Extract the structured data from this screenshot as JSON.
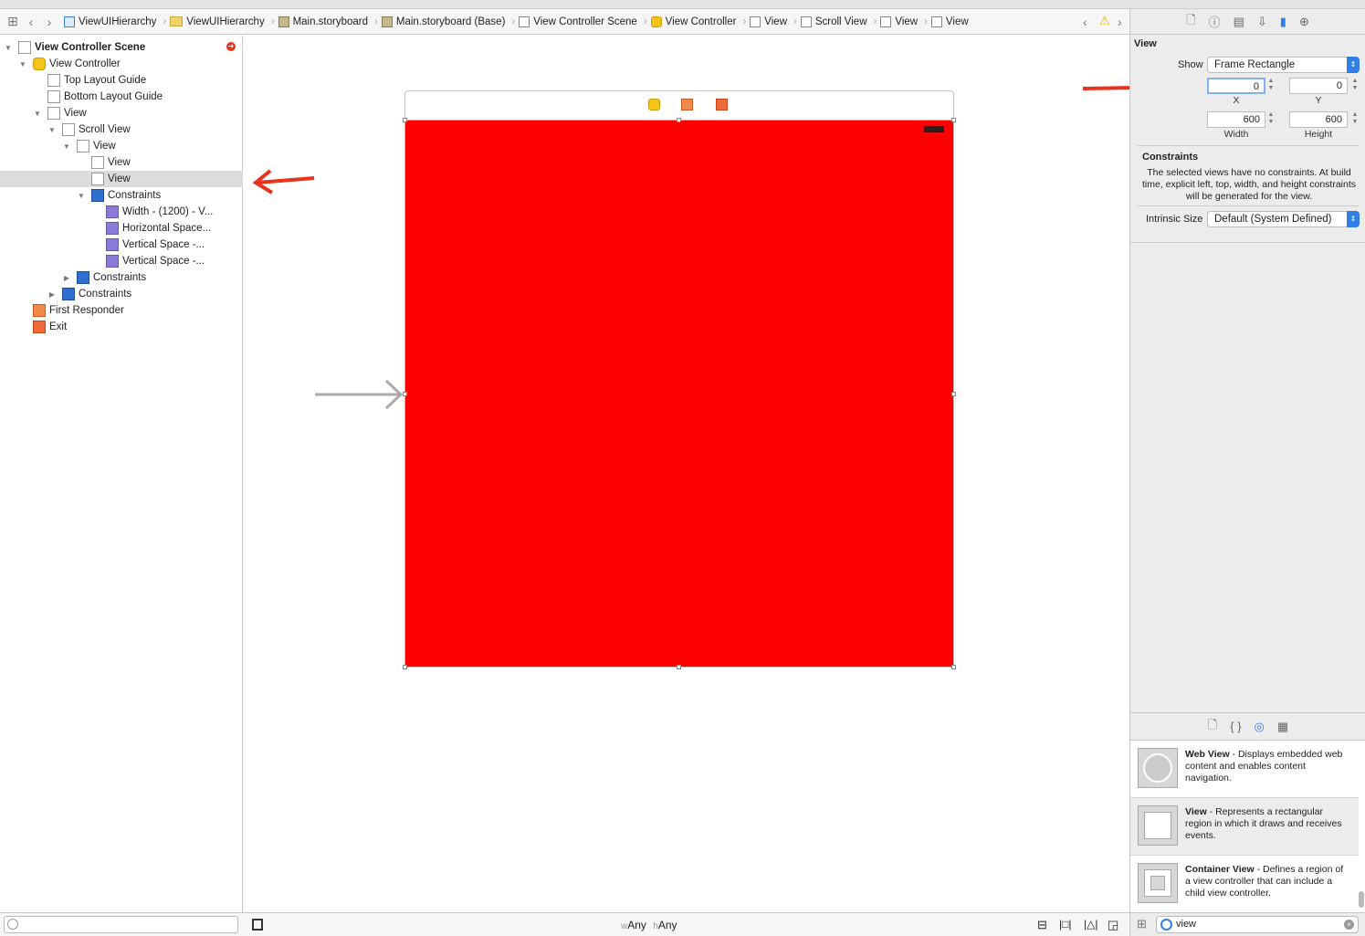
{
  "jumpbar": {
    "crumbs": [
      {
        "label": "ViewUIHierarchy",
        "icon": "project-file-icon"
      },
      {
        "label": "ViewUIHierarchy",
        "icon": "folder-icon"
      },
      {
        "label": "Main.storyboard",
        "icon": "storyboard-icon"
      },
      {
        "label": "Main.storyboard (Base)",
        "icon": "storyboard-icon"
      },
      {
        "label": "View Controller Scene",
        "icon": "scene-icon"
      },
      {
        "label": "View Controller",
        "icon": "view-controller-icon"
      },
      {
        "label": "View",
        "icon": "view-icon"
      },
      {
        "label": "Scroll View",
        "icon": "scroll-view-icon"
      },
      {
        "label": "View",
        "icon": "view-icon"
      },
      {
        "label": "View",
        "icon": "view-icon"
      }
    ]
  },
  "outline": {
    "items": [
      {
        "label": "View Controller Scene",
        "level": 0,
        "icon": "scene-icon",
        "expanded": true,
        "bold": true
      },
      {
        "label": "View Controller",
        "level": 1,
        "icon": "view-controller-icon",
        "expanded": true
      },
      {
        "label": "Top Layout Guide",
        "level": 2,
        "icon": "layout-guide-icon"
      },
      {
        "label": "Bottom Layout Guide",
        "level": 2,
        "icon": "layout-guide-icon"
      },
      {
        "label": "View",
        "level": 2,
        "icon": "view-icon",
        "expanded": true
      },
      {
        "label": "Scroll View",
        "level": 3,
        "icon": "scroll-view-icon",
        "expanded": true
      },
      {
        "label": "View",
        "level": 4,
        "icon": "view-icon",
        "expanded": true
      },
      {
        "label": "View",
        "level": 5,
        "icon": "view-icon"
      },
      {
        "label": "View",
        "level": 5,
        "icon": "view-icon",
        "selected": true
      },
      {
        "label": "Constraints",
        "level": 5,
        "icon": "constraints-icon",
        "expanded": true
      },
      {
        "label": "Width - (1200) - V...",
        "level": 6,
        "icon": "constraint-icon"
      },
      {
        "label": "Horizontal Space...",
        "level": 6,
        "icon": "constraint-icon"
      },
      {
        "label": "Vertical Space -...",
        "level": 6,
        "icon": "constraint-icon"
      },
      {
        "label": "Vertical Space -...",
        "level": 6,
        "icon": "constraint-icon"
      },
      {
        "label": "Constraints",
        "level": 4,
        "icon": "constraints-icon",
        "expanded": false
      },
      {
        "label": "Constraints",
        "level": 3,
        "icon": "constraints-icon",
        "expanded": false
      },
      {
        "label": "First Responder",
        "level": 1,
        "icon": "first-responder-icon"
      },
      {
        "label": "Exit",
        "level": 1,
        "icon": "exit-icon"
      }
    ]
  },
  "canvas": {
    "view_color": "#ff0000",
    "size_class_w": "w",
    "size_class_w_val": "Any",
    "size_class_h": "h",
    "size_class_h_val": "Any"
  },
  "inspector": {
    "section_title": "View",
    "show_label": "Show",
    "show_value": "Frame Rectangle",
    "x": "0",
    "x_label": "X",
    "y": "0",
    "y_label": "Y",
    "width": "600",
    "width_label": "Width",
    "height": "600",
    "height_label": "Height",
    "constraints_title": "Constraints",
    "constraints_text": "The selected views have no constraints. At build time, explicit left, top, width, and height constraints will be generated for the view.",
    "intrinsic_label": "Intrinsic Size",
    "intrinsic_value": "Default (System Defined)"
  },
  "library": {
    "items": [
      {
        "name": "Web View",
        "desc": " - Displays embedded web content and enables content navigation."
      },
      {
        "name": "View",
        "desc": " - Represents a rectangular region in which it draws and receives events."
      },
      {
        "name": "Container View",
        "desc": " - Defines a region of a view controller that can include a child view controller."
      }
    ],
    "filter_value": "view"
  },
  "colors": {
    "accent": "#2f7fe6",
    "annotation_arrow": "#e8321c"
  }
}
